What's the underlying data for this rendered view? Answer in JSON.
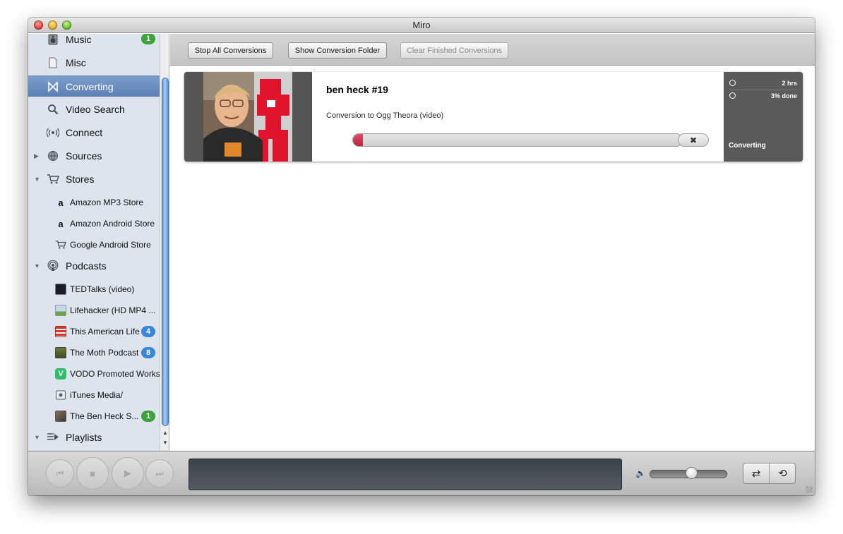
{
  "window": {
    "title": "Miro"
  },
  "sidebar": {
    "items": [
      {
        "label": "Music",
        "icon": "speaker-icon",
        "badge": "1"
      },
      {
        "label": "Misc",
        "icon": "document-icon"
      },
      {
        "label": "Converting",
        "icon": "converting-icon",
        "selected": true
      },
      {
        "label": "Video Search",
        "icon": "magnifier-icon"
      },
      {
        "label": "Connect",
        "icon": "wireless-icon"
      },
      {
        "label": "Sources",
        "icon": "globe-icon",
        "expanded": false
      },
      {
        "label": "Stores",
        "icon": "cart-icon",
        "expanded": true
      },
      {
        "label": "Amazon MP3 Store",
        "icon": "amazon-icon"
      },
      {
        "label": "Amazon Android Store",
        "icon": "amazon-icon"
      },
      {
        "label": "Google Android Store",
        "icon": "cart-icon"
      },
      {
        "label": "Podcasts",
        "icon": "podcast-icon",
        "expanded": true
      },
      {
        "label": "TEDTalks (video)",
        "icon": "tedtalks-thumbnail"
      },
      {
        "label": "Lifehacker (HD MP4 ...",
        "icon": "lifehacker-thumbnail"
      },
      {
        "label": "This American Life",
        "icon": "this-american-life-thumbnail",
        "badge": "4"
      },
      {
        "label": "The Moth Podcast",
        "icon": "moth-thumbnail",
        "badge": "8"
      },
      {
        "label": "VODO Promoted Works",
        "icon": "vodo-thumbnail"
      },
      {
        "label": "iTunes Media/",
        "icon": "folder-icon"
      },
      {
        "label": "The Ben Heck S...",
        "icon": "ben-heck-thumbnail",
        "badge": "1"
      },
      {
        "label": "Playlists",
        "icon": "playlist-icon",
        "expanded": true
      }
    ]
  },
  "toolbar": {
    "stop_all": "Stop All Conversions",
    "show_folder": "Show Conversion Folder",
    "clear_finished": "Clear Finished Conversions"
  },
  "conversion": {
    "title": "ben heck #19",
    "subtitle": "Conversion to Ogg Theora (video)",
    "progress_fraction": 0.03,
    "cancel_glyph": "✖",
    "eta": "2 hrs",
    "percent_done": "3% done",
    "status": "Converting"
  },
  "player": {
    "volume_fraction": 0.55
  },
  "colors": {
    "selection": "#6b8ec0",
    "progress_fill": "#c8304f",
    "badge_green": "#3ea23a",
    "badge_blue": "#3a86d7"
  }
}
